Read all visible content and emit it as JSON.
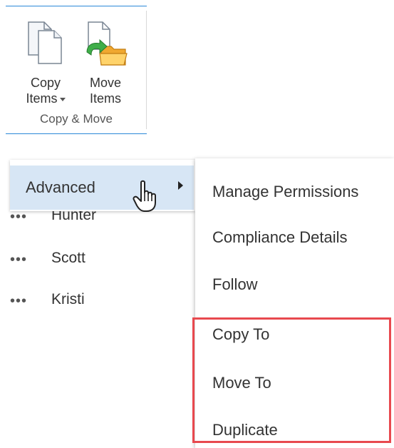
{
  "ribbon": {
    "copy_items": {
      "line1": "Copy",
      "line2": "Items",
      "icon": "copy-documents-icon"
    },
    "move_items": {
      "line1": "Move",
      "line2": "Items",
      "icon": "move-to-folder-icon"
    },
    "group_title": "Copy & Move"
  },
  "context_menu": {
    "advanced_label": "Advanced",
    "submenu_arrow_icon": "chevron-right-icon",
    "cursor_icon": "hand-pointer-icon"
  },
  "list": {
    "rows": [
      {
        "name": "Hunter"
      },
      {
        "name": "Scott"
      },
      {
        "name": "Kristi"
      }
    ],
    "more_glyph": "•••"
  },
  "submenu": {
    "items": [
      {
        "label": "Manage Permissions"
      },
      {
        "label": "Compliance Details"
      },
      {
        "label": "Follow"
      },
      {
        "label": "Copy To"
      },
      {
        "label": "Move To"
      },
      {
        "label": "Duplicate"
      }
    ],
    "highlight_color": "#e8494f"
  },
  "colors": {
    "accent": "#2b88d8",
    "selected_bg": "#d7e6f5",
    "text": "#333333"
  }
}
